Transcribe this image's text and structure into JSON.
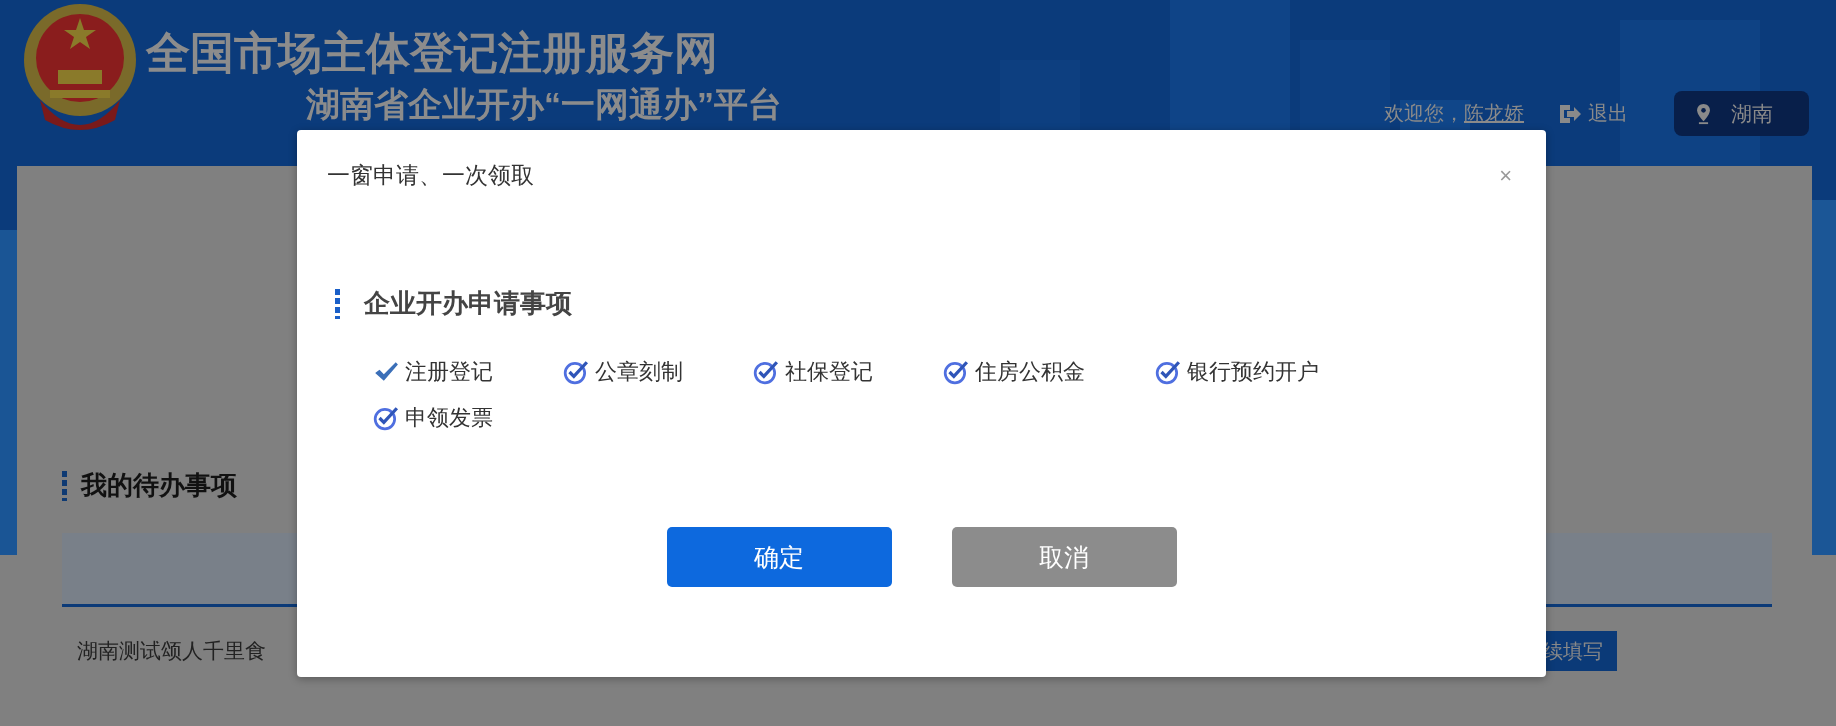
{
  "header": {
    "site_title": "全国市场主体登记注册服务网",
    "platform_title": "湖南省企业开办“一网通办”平台",
    "welcome": "欢迎您，",
    "user_name": "陈龙娇",
    "logout": "退出",
    "region": "湖南"
  },
  "page": {
    "section_title": "我的待办事项",
    "rows": [
      {
        "name": "湖南测试颂人千里食",
        "action": "续填写"
      }
    ]
  },
  "dialog": {
    "title": "一窗申请、一次领取",
    "close": "×",
    "section_title": "企业开办申请事项",
    "items": [
      {
        "label": "注册登记",
        "kind": "tick",
        "checked": true
      },
      {
        "label": "公章刻制",
        "kind": "circle",
        "checked": true
      },
      {
        "label": "社保登记",
        "kind": "circle",
        "checked": true
      },
      {
        "label": "住房公积金",
        "kind": "circle",
        "checked": true
      },
      {
        "label": "银行预约开户",
        "kind": "circle",
        "checked": true
      },
      {
        "label": "申领发票",
        "kind": "circle",
        "checked": true
      }
    ],
    "buttons": [
      {
        "label": "确定",
        "kind": "primary"
      },
      {
        "label": "取消",
        "kind": "secondary"
      }
    ]
  }
}
